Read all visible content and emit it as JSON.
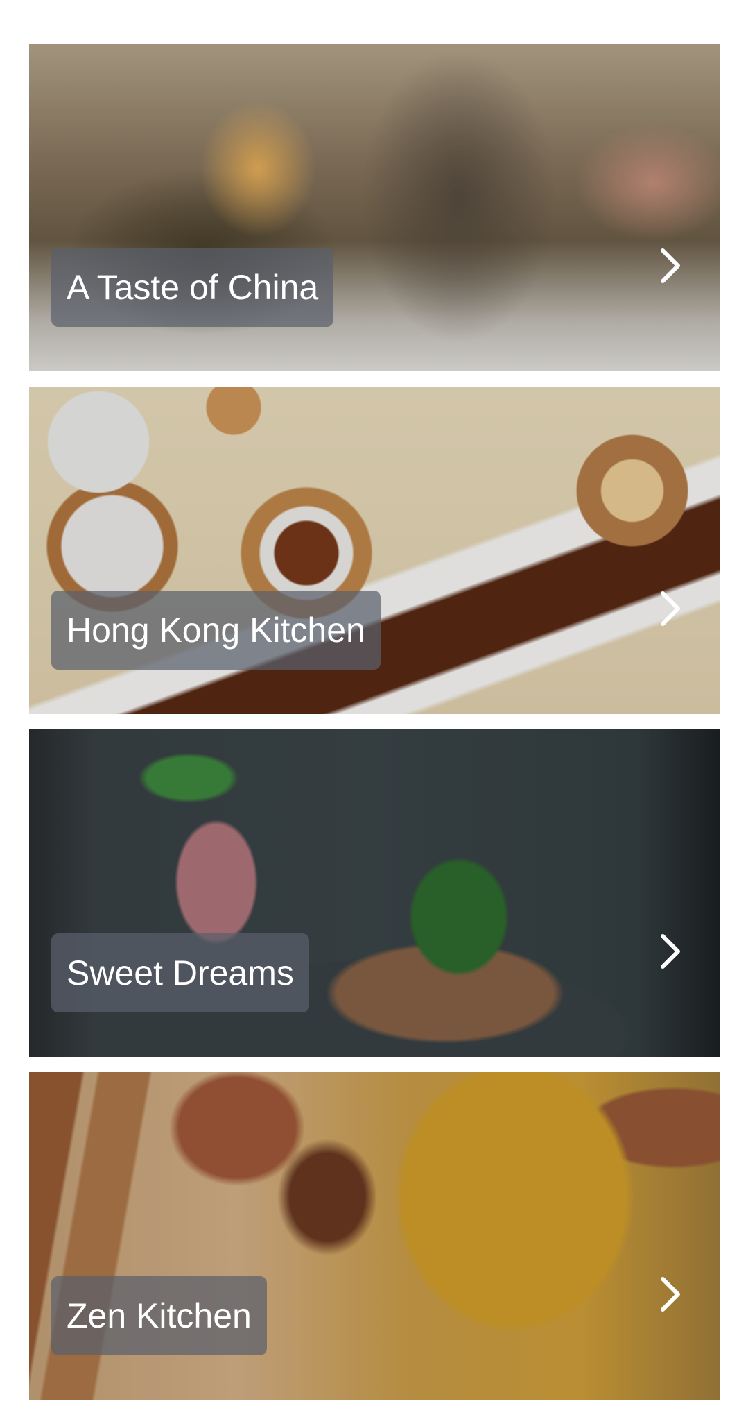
{
  "restaurants": [
    {
      "name": "A Taste of China"
    },
    {
      "name": "Hong Kong Kitchen"
    },
    {
      "name": "Sweet Dreams"
    },
    {
      "name": "Zen Kitchen"
    }
  ],
  "icons": {
    "chevron": "chevron-right-icon"
  },
  "colors": {
    "label_background": "#5a606c",
    "label_text": "#ffffff",
    "page_background": "#ffffff"
  }
}
